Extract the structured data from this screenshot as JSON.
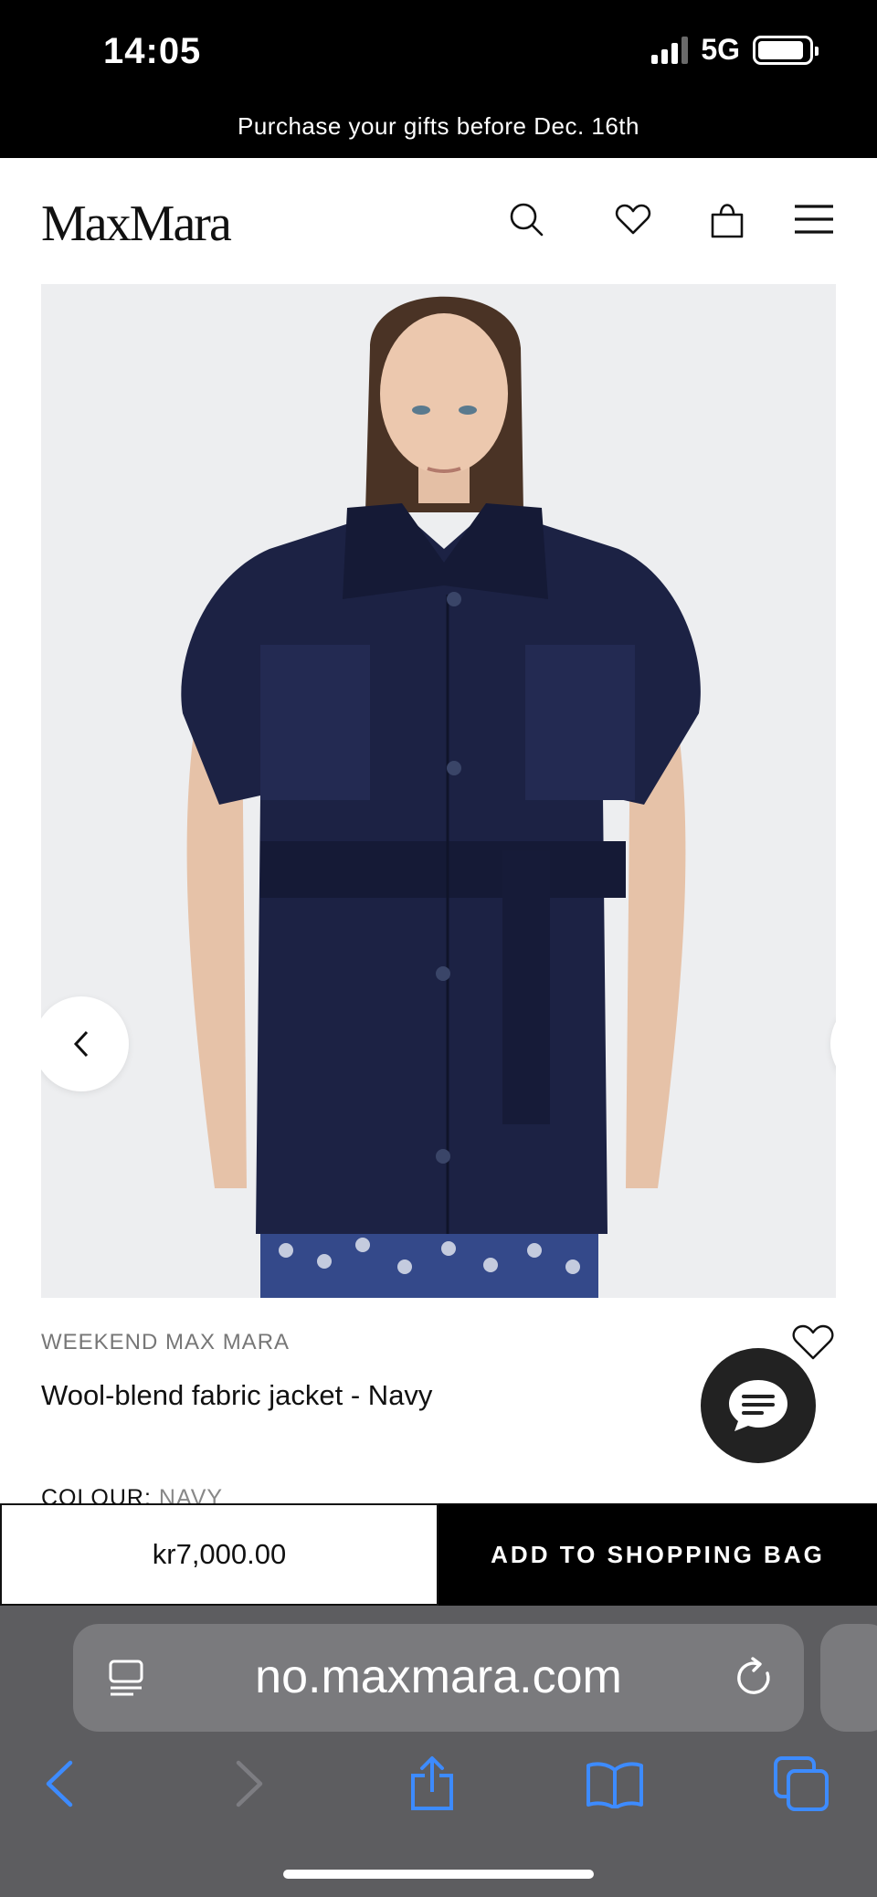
{
  "status_bar": {
    "time": "14:05",
    "network": "5G",
    "signal_bars_active": 3,
    "signal_bars_total": 4,
    "battery_level": 0.9
  },
  "promo_banner": {
    "text": "Purchase your gifts before Dec. 16th"
  },
  "header": {
    "logo": "MaxMara",
    "icons": [
      "search-icon",
      "heart-icon",
      "shopping-bag-icon",
      "menu-icon"
    ]
  },
  "gallery": {
    "prev_icon": "chevron-left-icon",
    "next_icon": "chevron-right-icon",
    "colors": {
      "background": "#edeef0",
      "garment": "#1c2244"
    }
  },
  "product": {
    "brand": "WEEKEND MAX MARA",
    "name": "Wool-blend fabric jacket - Navy",
    "colour_label": "COLOUR:",
    "colour_value": "NAVY"
  },
  "purchase": {
    "price": "kr7,000.00",
    "add_to_bag_label": "ADD TO SHOPPING BAG"
  },
  "browser": {
    "url": "no.maxmara.com",
    "colors": {
      "toolbar_bg": "#5d5d60",
      "accent": "#3d8bff"
    },
    "toolbar_icons": [
      "back-icon",
      "forward-icon",
      "share-icon",
      "bookmarks-icon",
      "tabs-icon"
    ]
  }
}
